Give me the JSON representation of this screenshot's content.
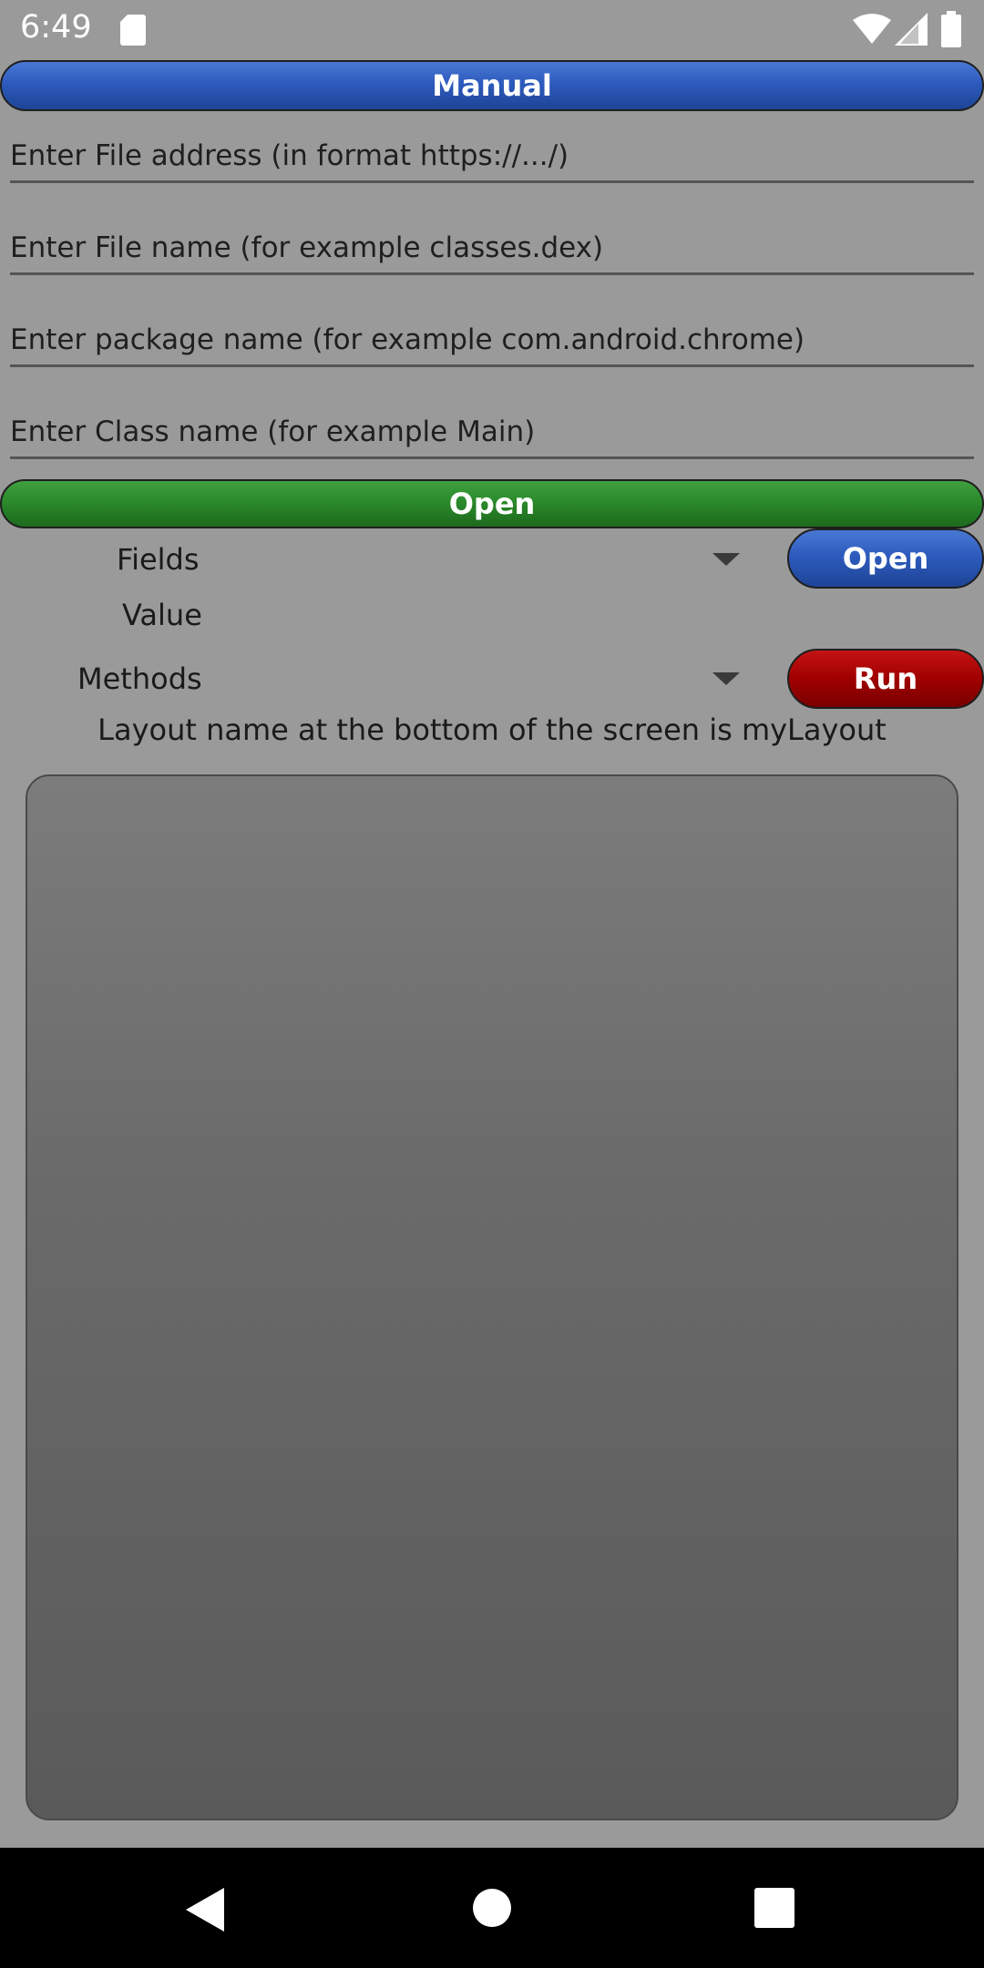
{
  "status_bar": {
    "time": "6:49"
  },
  "buttons": {
    "manual": "Manual",
    "open_main": "Open",
    "open_fields": "Open",
    "run": "Run"
  },
  "inputs": {
    "file_address_placeholder": "Enter File address (in format https://.../)",
    "file_name_placeholder": "Enter File name (for example classes.dex)",
    "package_name_placeholder": "Enter package name (for example com.android.chrome)",
    "class_name_placeholder": "Enter Class name (for example Main)"
  },
  "spinners": {
    "fields_selected": "Fields",
    "methods_selected": "Methods"
  },
  "value_label": "Value",
  "info_text": "Layout name at the bottom of the screen is myLayout",
  "colors": {
    "manual_button": "#2d5bbd",
    "open_main_button": "#2b8a2b",
    "open_fields_button": "#2d5bbd",
    "run_button": "#a00000",
    "background": "#9a9a9a"
  },
  "icons": {
    "status": [
      "sd-card-icon",
      "wifi-icon",
      "cell-signal-icon",
      "battery-icon"
    ],
    "nav": [
      "back-icon",
      "home-icon",
      "recents-icon"
    ]
  }
}
